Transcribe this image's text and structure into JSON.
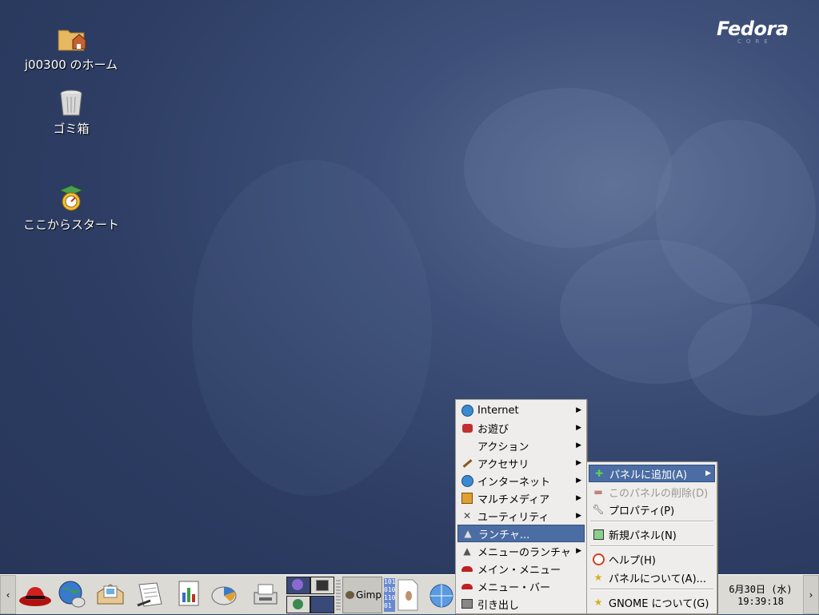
{
  "brand": {
    "name": "Fedora",
    "sub": "CORE"
  },
  "desktop_icons": [
    {
      "label": "j00300 のホーム",
      "icon": "home-folder-icon"
    },
    {
      "label": "ゴミ箱",
      "icon": "trash-icon"
    },
    {
      "label": "ここからスタート",
      "icon": "start-here-icon"
    }
  ],
  "panel": {
    "left_arrow": "‹",
    "right_arrow": "›",
    "gimp_label": "Gimp",
    "clock": {
      "date": "6月30日 (水)",
      "time": "19:39:18"
    }
  },
  "main_menu": {
    "items": [
      {
        "label": "Internet",
        "icon": "globe-icon",
        "submenu": true
      },
      {
        "label": "お遊び",
        "icon": "games-icon",
        "submenu": true
      },
      {
        "label": "アクション",
        "icon": "",
        "submenu": true
      },
      {
        "label": "アクセサリ",
        "icon": "brush-icon",
        "submenu": true
      },
      {
        "label": "インターネット",
        "icon": "globe-icon",
        "submenu": true
      },
      {
        "label": "マルチメディア",
        "icon": "multimedia-icon",
        "submenu": true
      },
      {
        "label": "ユーティリティ",
        "icon": "tools-icon",
        "submenu": true
      },
      {
        "label": "ランチャ...",
        "icon": "rocket-icon",
        "submenu": false,
        "selected": true
      },
      {
        "label": "メニューのランチャ",
        "icon": "rocket-icon",
        "submenu": true
      },
      {
        "label": "メイン・メニュー",
        "icon": "redhat-icon",
        "submenu": false
      },
      {
        "label": "メニュー・バー",
        "icon": "redhat-icon",
        "submenu": false
      },
      {
        "label": "引き出し",
        "icon": "drawer-icon",
        "submenu": false
      }
    ]
  },
  "panel_menu": {
    "items": [
      {
        "label": "パネルに追加(A)",
        "icon": "add-icon",
        "submenu": true,
        "selected": true
      },
      {
        "label": "このパネルの削除(D)",
        "icon": "remove-icon",
        "disabled": true
      },
      {
        "label": "プロパティ(P)",
        "icon": "wrench-icon"
      },
      {
        "label": "新規パネル(N)",
        "icon": "new-panel-icon"
      },
      {
        "label": "ヘルプ(H)",
        "icon": "help-icon"
      },
      {
        "label": "パネルについて(A)...",
        "icon": "star-icon"
      },
      {
        "label": "GNOME について(G)",
        "icon": "star-icon"
      }
    ]
  }
}
